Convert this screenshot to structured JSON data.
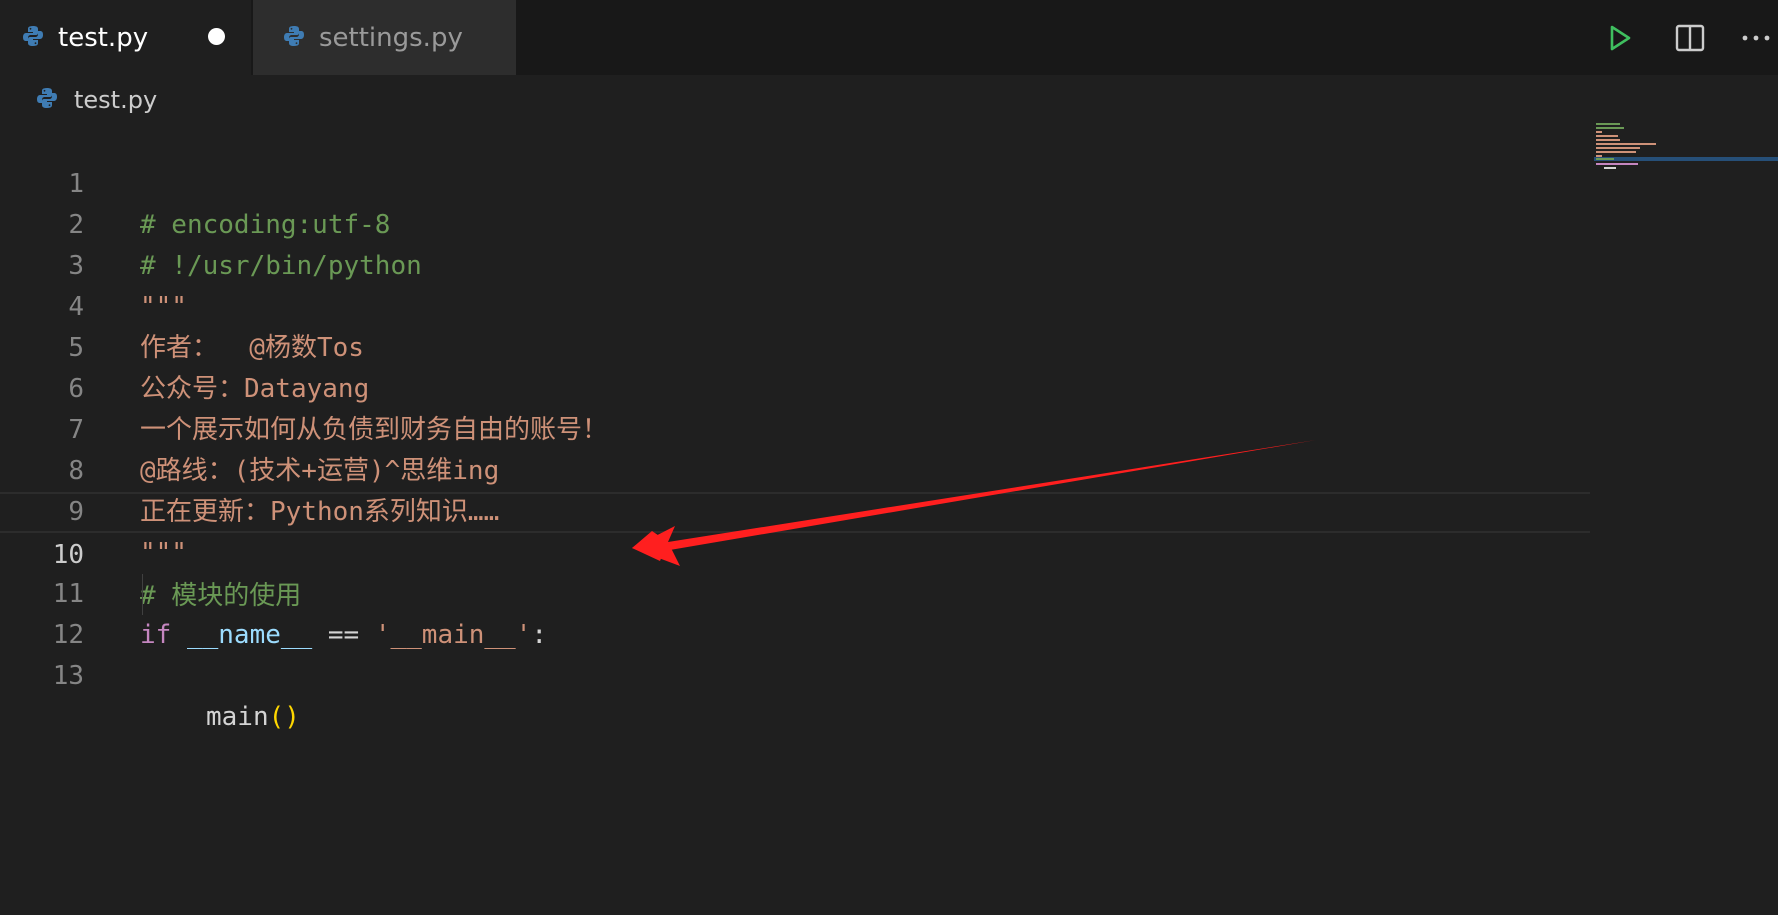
{
  "tabs": [
    {
      "label": "test.py",
      "active": true,
      "modified": true
    },
    {
      "label": "settings.py",
      "active": false,
      "modified": false
    }
  ],
  "actions": {
    "run": "play-icon",
    "split": "split-editor-icon",
    "more": "more-actions-icon"
  },
  "breadcrumb": {
    "file": "test.py"
  },
  "editor": {
    "lines": [
      {
        "num": "1"
      },
      {
        "num": "2"
      },
      {
        "num": "3"
      },
      {
        "num": "4"
      },
      {
        "num": "5"
      },
      {
        "num": "6"
      },
      {
        "num": "7"
      },
      {
        "num": "8"
      },
      {
        "num": "9"
      },
      {
        "num": "10"
      },
      {
        "num": "11"
      },
      {
        "num": "12"
      },
      {
        "num": "13"
      }
    ],
    "code": {
      "l1": "# encoding:utf-8",
      "l2": "# !/usr/bin/python",
      "l3": "\"\"\"",
      "l4": "作者：  @杨数Tos",
      "l5": "公众号：Datayang",
      "l6": "一个展示如何从负债到财务自由的账号！",
      "l7": "@路线：(技术+运营)^思维ing",
      "l8": "正在更新：Python系列知识……",
      "l9": "\"\"\"",
      "l10": "# 模块的使用",
      "l11_kw": "if",
      "l11_var": "__name__",
      "l11_op": "==",
      "l11_str": "'__main__'",
      "l11_colon": ":",
      "l12_func": "main",
      "l12_paren": "()"
    },
    "current_line": 10
  },
  "colors": {
    "background": "#1f1f1f",
    "comment": "#6a9955",
    "string": "#ce9178",
    "keyword": "#c586c0",
    "variable": "#9cdcfe",
    "annotation_arrow": "#ff1f1f"
  }
}
